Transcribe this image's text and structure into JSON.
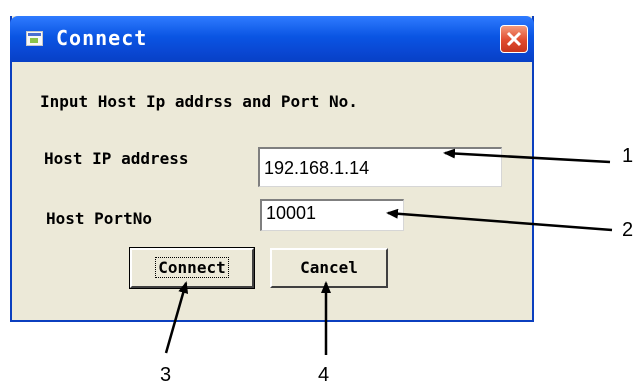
{
  "window": {
    "title": "Connect",
    "icon": "window-app-icon",
    "close_icon": "close-icon"
  },
  "dialog": {
    "prompt": "Input Host Ip addrss and Port No.",
    "host_ip_label": "Host IP address",
    "host_ip_value": "192.168.1.14",
    "host_port_label": "Host PortNo",
    "host_port_value": "10001",
    "connect_label": "Connect",
    "cancel_label": "Cancel"
  },
  "annotations": {
    "a1": "1",
    "a2": "2",
    "a3": "3",
    "a4": "4"
  }
}
